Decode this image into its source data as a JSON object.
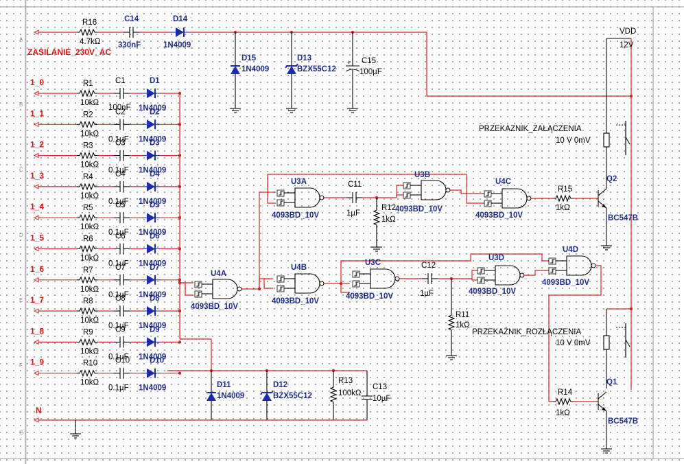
{
  "nets": {
    "supply_in": "ZASILANIE_230V_AC",
    "neutral": "N",
    "vdd": "VDD",
    "vdd_value": "12V",
    "inputs": [
      "1_0",
      "1_1",
      "1_2",
      "1_3",
      "1_4",
      "1_5",
      "1_6",
      "1_7",
      "1_8",
      "1_9"
    ]
  },
  "supply": {
    "r16": {
      "ref": "R16",
      "value": "4.7kΩ"
    },
    "c14": {
      "ref": "C14",
      "value": "330nF"
    },
    "d14": {
      "ref": "D14",
      "value": "1N4009"
    },
    "d15": {
      "ref": "D15",
      "value": "1N4009"
    },
    "d13": {
      "ref": "D13",
      "value": "BZX55C12"
    },
    "c15": {
      "ref": "C15",
      "value": "100µF"
    }
  },
  "input_rows": [
    {
      "r": "R1",
      "rv": "10kΩ",
      "c": "C1",
      "cv": "100nF",
      "d": "D1",
      "dv": "1N4009"
    },
    {
      "r": "R2",
      "rv": "10kΩ",
      "c": "C2",
      "cv": "0.1µF",
      "d": "D2",
      "dv": "1N4009"
    },
    {
      "r": "R3",
      "rv": "10kΩ",
      "c": "C3",
      "cv": "0.1µF",
      "d": "D3",
      "dv": "1N4009"
    },
    {
      "r": "R4",
      "rv": "10kΩ",
      "c": "C4",
      "cv": "0.1µF",
      "d": "D4",
      "dv": "1N4009"
    },
    {
      "r": "R5",
      "rv": "10kΩ",
      "c": "C5",
      "cv": "0.1µF",
      "d": "D5",
      "dv": "1N4009"
    },
    {
      "r": "R6",
      "rv": "10kΩ",
      "c": "C6",
      "cv": "0.1µF",
      "d": "D6",
      "dv": "1N4009"
    },
    {
      "r": "R7",
      "rv": "10kΩ",
      "c": "C7",
      "cv": "0.1µF",
      "d": "D7",
      "dv": "1N4009"
    },
    {
      "r": "R8",
      "rv": "10kΩ",
      "c": "C8",
      "cv": "0.1µF",
      "d": "D8",
      "dv": "1N4009"
    },
    {
      "r": "R9",
      "rv": "10kΩ",
      "c": "C9",
      "cv": "0.1µF",
      "d": "D9",
      "dv": "1N4009"
    },
    {
      "r": "R10",
      "rv": "10kΩ",
      "c": "C10",
      "cv": "0.1µF",
      "d": "D10",
      "dv": "1N4009"
    }
  ],
  "bottom": {
    "d11": {
      "ref": "D11",
      "value": "1N4009"
    },
    "d12": {
      "ref": "D12",
      "value": "BZX55C12"
    },
    "r13": {
      "ref": "R13",
      "value": "100kΩ"
    },
    "c13": {
      "ref": "C13",
      "value": "10µF"
    }
  },
  "gates": {
    "part": "4093BD_10V",
    "u4a": "U4A",
    "u4b": "U4B",
    "u3a": "U3A",
    "u3b": "U3B",
    "u3c": "U3C",
    "u3d": "U3D",
    "u4c": "U4C",
    "u4d": "U4D"
  },
  "timing": {
    "c11": {
      "ref": "C11",
      "value": "1µF"
    },
    "r12": {
      "ref": "R12",
      "value": "1kΩ"
    },
    "c12": {
      "ref": "C12",
      "value": "1µF"
    },
    "r11": {
      "ref": "R11",
      "value": "1kΩ"
    }
  },
  "outputs": {
    "relay_on": {
      "label": "PRZEKAZNIK_ZAŁĄCZENIA",
      "rating": "10 V 0mV"
    },
    "relay_off": {
      "label": "PRZEKAŹNIK_ROZŁĄCZENIA",
      "rating": "10 V 0mV"
    },
    "r15": {
      "ref": "R15",
      "value": "1kΩ"
    },
    "r14": {
      "ref": "R14",
      "value": "1kΩ"
    },
    "q2": {
      "ref": "Q2",
      "value": "BC547B"
    },
    "q1": {
      "ref": "Q1",
      "value": "BC547B"
    }
  },
  "ruler_rows": [
    "A",
    "B",
    "C",
    "D",
    "E",
    "F",
    "G"
  ]
}
